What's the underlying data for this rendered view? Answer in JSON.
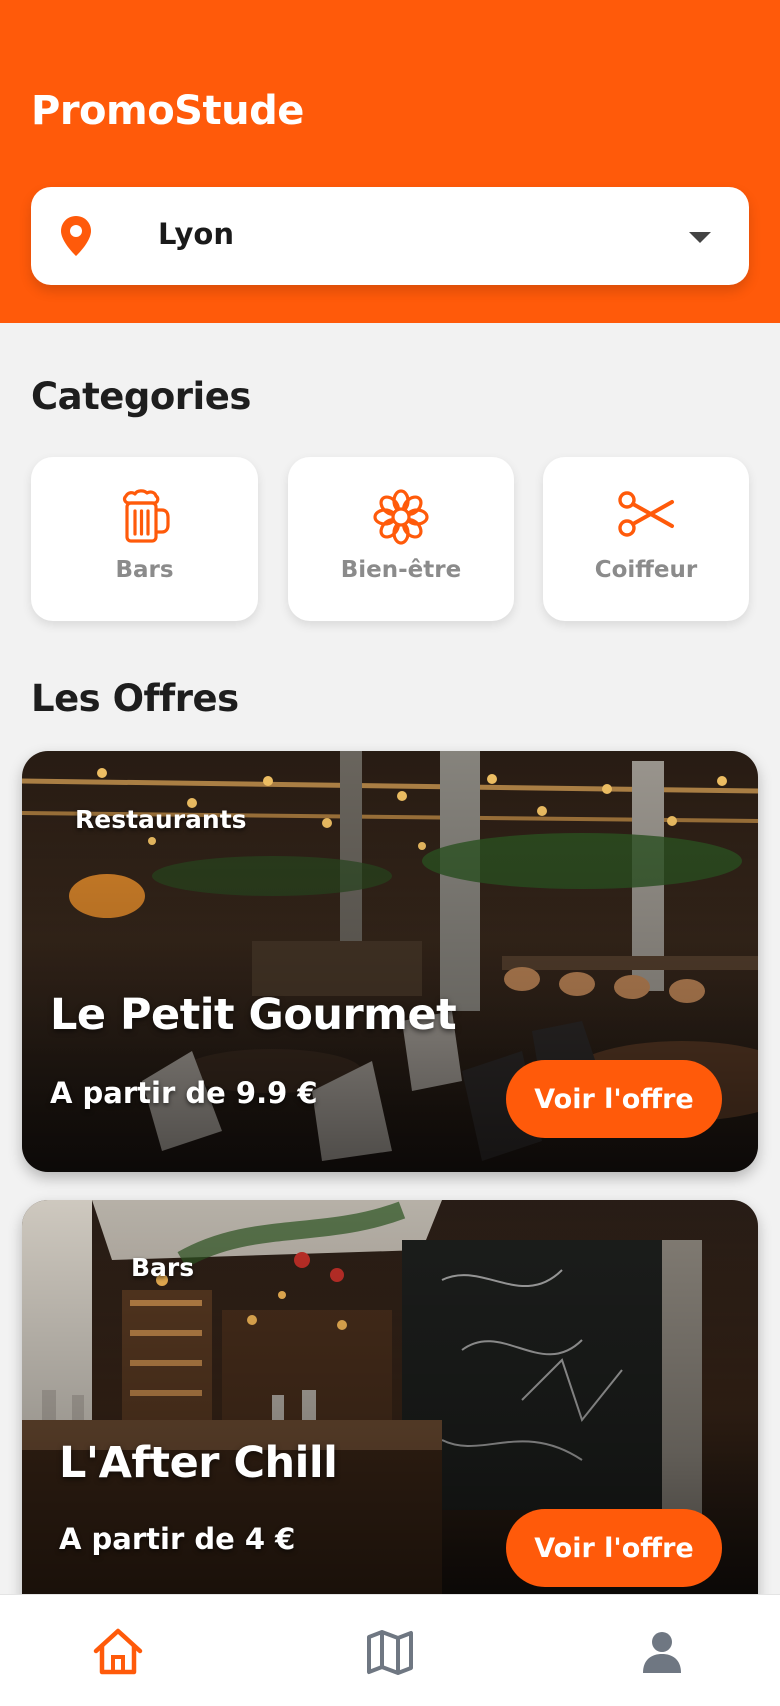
{
  "app": {
    "title": "PromoStude"
  },
  "location": {
    "city": "Lyon",
    "icon": "location-pin-icon"
  },
  "categories": {
    "title": "Categories",
    "items": [
      {
        "label": "Bars",
        "icon": "beer-mug-icon"
      },
      {
        "label": "Bien-être",
        "icon": "flower-icon"
      },
      {
        "label": "Coiffeur",
        "icon": "scissors-icon"
      }
    ]
  },
  "offers": {
    "title": "Les Offres",
    "items": [
      {
        "category": "Restaurants",
        "name": "Le Petit Gourmet",
        "price": "A partir de 9.9 €",
        "button": "Voir l'offre"
      },
      {
        "category": "Bars",
        "name": "L'After Chill",
        "price": "A partir de 4 €",
        "button": "Voir l'offre"
      }
    ]
  },
  "nav": {
    "items": [
      {
        "icon": "home-icon",
        "active": true
      },
      {
        "icon": "map-icon",
        "active": false
      },
      {
        "icon": "profile-icon",
        "active": false
      }
    ]
  },
  "colors": {
    "accent": "#ff5a0a",
    "background": "#f2f2f2",
    "muted": "#8b8b8b",
    "nav_inactive": "#6f7782"
  }
}
